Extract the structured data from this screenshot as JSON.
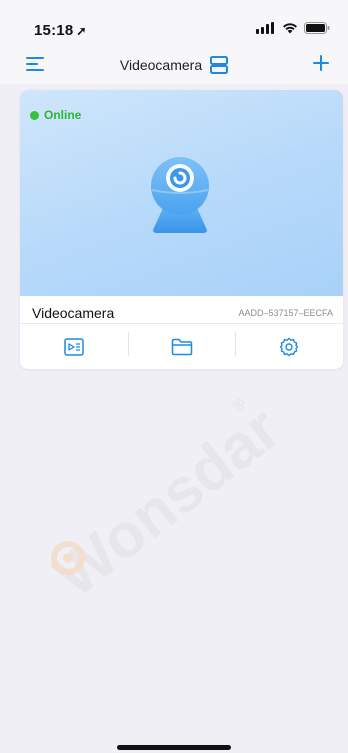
{
  "status_bar": {
    "time": "15:18",
    "location_glyph": "➚",
    "signal_text": "::!!"
  },
  "nav": {
    "title": "Videocamera",
    "menu_icon": "hamburger-menu-icon",
    "layout_icon": "two-row-layout-icon",
    "add_icon": "plus-icon"
  },
  "device_card": {
    "status": "Online",
    "name": "Videocamera",
    "uid": "AADD–537157–EECFA",
    "actions": [
      {
        "icon": "playback-icon"
      },
      {
        "icon": "folder-icon"
      },
      {
        "icon": "settings-gear-icon"
      }
    ]
  },
  "watermark": {
    "text": "Wonsdar",
    "trademark": "®"
  },
  "colors": {
    "accent": "#1e88e5",
    "online": "#35c43c",
    "background": "#f0eff5",
    "preview": "#b6d9fa"
  }
}
